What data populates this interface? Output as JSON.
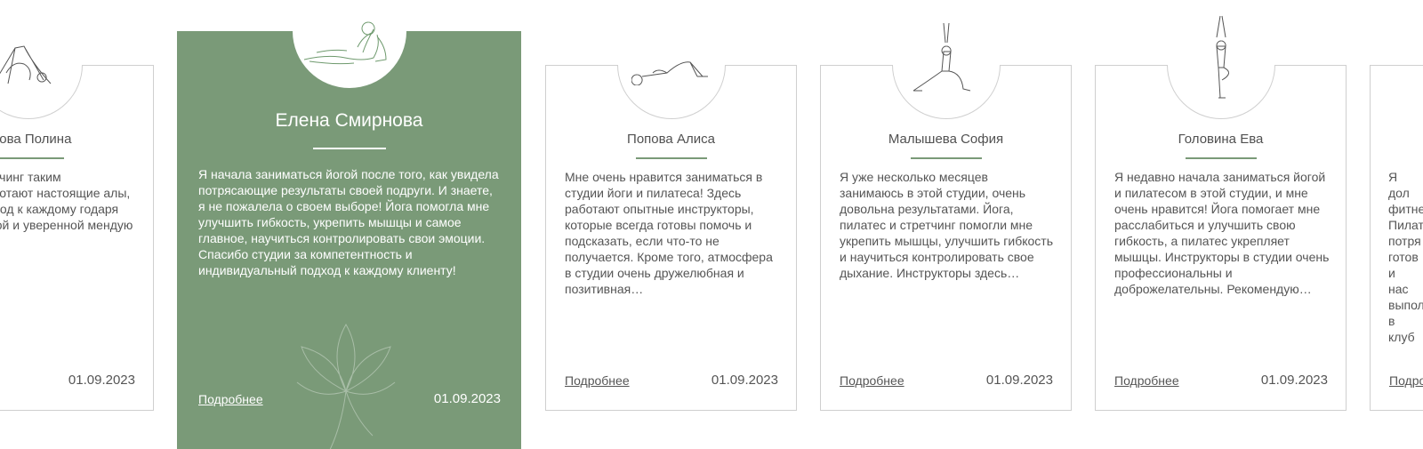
{
  "colors": {
    "accent": "#7a9a78",
    "text": "#555555",
    "border": "#cfcfcf"
  },
  "more_label": "Подробнее",
  "cards": [
    {
      "name": "арова Полина",
      "pose_icon": "downward-dog-pose-icon",
      "text": "умала, что стретчинг таким увлекательным! отают настоящие алы, которые умеют ход к каждому годаря занятиям е гибкой и уверенной мендую всем, кто хоче…",
      "date": "01.09.2023"
    },
    {
      "name": "Елена Смирнова",
      "pose_icon": "cobra-pose-icon",
      "featured": true,
      "text": "Я начала заниматься йогой после того, как увидела потрясающие результаты своей подруги. И знаете, я не пожалела о своем выборе! Йога помогла мне улучшить гибкость, укрепить  мышцы и самое главное, научиться контролировать свои эмоции. Спасибо студии за компетентность и индивидуальный подход к каждому клиенту!",
      "date": "01.09.2023"
    },
    {
      "name": "Попова Алиса",
      "pose_icon": "bridge-pose-icon",
      "text": "Мне очень нравится заниматься в студии йоги и пилатеса! Здесь работают опытные инструкторы, которые всегда готовы помочь и подсказать, если что-то не получается. Кроме того, атмосфера в студии очень дружелюбная и позитивная…",
      "date": "01.09.2023"
    },
    {
      "name": "Малышева София",
      "pose_icon": "crescent-lunge-pose-icon",
      "text": "Я уже несколько месяцев занимаюсь в этой студии, очень довольна результатами. Йога, пилатес и стретчинг помогли мне укрепить мышцы, улучшить гибкость и научиться контролировать свое дыхание. Инструкторы здесь…",
      "date": "01.09.2023"
    },
    {
      "name": "Головина Ева",
      "pose_icon": "tree-pose-icon",
      "text": "Я недавно начала заниматься йогой и пилатесом в этой студии, и мне очень нравится! Йога помогает мне расслабиться и улучшить свою гибкость, а пилатес укрепляет мышцы. Инструкторы в студии очень профессиональны и доброжелательны. Рекомендую…",
      "date": "01.09.2023"
    },
    {
      "name": "",
      "text": "Я дол фитне Пилат потря готов и нас выпол в клуб"
    }
  ]
}
